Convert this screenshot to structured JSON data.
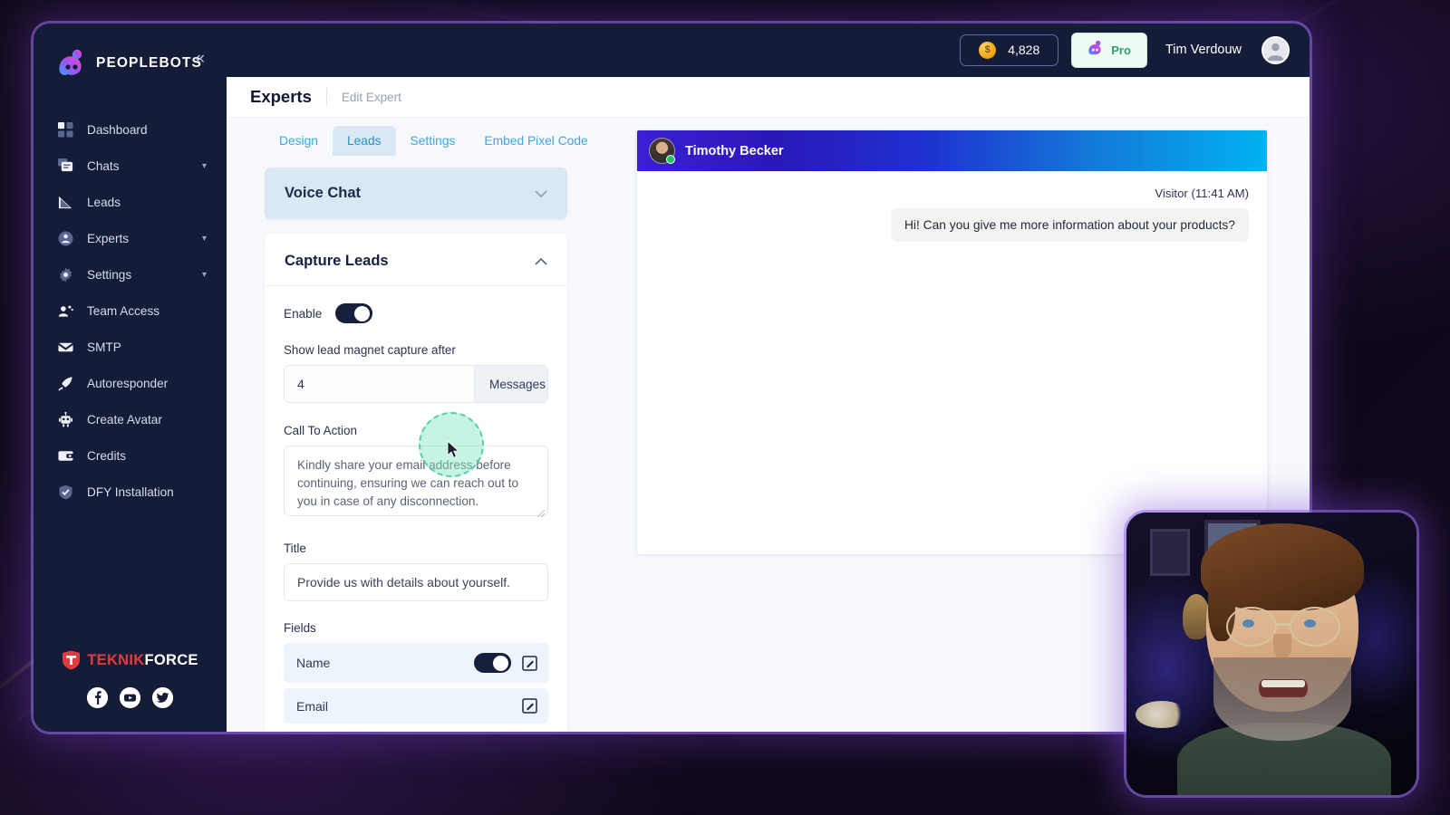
{
  "brand": {
    "name": "PEOPLEBOTS",
    "logo_icon": "peoplebots-logo-icon",
    "collapse_icon": "chevron-double-left-icon"
  },
  "sidebar": {
    "items": [
      {
        "label": "Dashboard",
        "icon": "grid-icon",
        "caret": false
      },
      {
        "label": "Chats",
        "icon": "chat-icon",
        "caret": true
      },
      {
        "label": "Leads",
        "icon": "funnel-icon",
        "caret": false
      },
      {
        "label": "Experts",
        "icon": "user-badge-icon",
        "caret": true
      },
      {
        "label": "Settings",
        "icon": "gear-icon",
        "caret": true
      },
      {
        "label": "Team Access",
        "icon": "team-icon",
        "caret": false
      },
      {
        "label": "SMTP",
        "icon": "envelope-icon",
        "caret": false
      },
      {
        "label": "Autoresponder",
        "icon": "rocket-icon",
        "caret": false
      },
      {
        "label": "Create Avatar",
        "icon": "robot-icon",
        "caret": false
      },
      {
        "label": "Credits",
        "icon": "wallet-icon",
        "caret": false
      },
      {
        "label": "DFY Installation",
        "icon": "shield-check-icon",
        "caret": false
      }
    ],
    "footer": {
      "logo_red": "TEKNIK",
      "logo_white": "FORCE",
      "socials": [
        "facebook-icon",
        "youtube-icon",
        "twitter-icon"
      ]
    }
  },
  "topbar": {
    "credits_value": "4,828",
    "coin_icon": "coin-icon",
    "plan_badge": "Pro",
    "plan_icon": "peoplebots-mini-icon",
    "user_name": "Tim Verdouw",
    "avatar_icon": "user-avatar-icon"
  },
  "page": {
    "title": "Experts",
    "breadcrumb": "Edit Expert"
  },
  "tabs": [
    {
      "label": "Design",
      "active": false
    },
    {
      "label": "Leads",
      "active": true
    },
    {
      "label": "Settings",
      "active": false
    },
    {
      "label": "Embed Pixel Code",
      "active": false
    }
  ],
  "voice_panel": {
    "title": "Voice Chat",
    "chevron": "chevron-down-icon"
  },
  "capture_panel": {
    "title": "Capture Leads",
    "chevron": "chevron-up-icon",
    "enable_label": "Enable",
    "enable_on": true,
    "messages_label": "Show lead magnet capture after",
    "messages_value": "4",
    "messages_suffix": "Messages",
    "cta_label": "Call To Action",
    "cta_value": "Kindly share your email address before continuing, ensuring we can reach out to you in case of any disconnection.",
    "title_label": "Title",
    "title_value": "Provide us with details about yourself.",
    "fields_label": "Fields",
    "fields": [
      {
        "name": "Name",
        "toggle": true,
        "edit_icon": "edit-square-icon"
      },
      {
        "name": "Email",
        "toggle": false,
        "edit_icon": "edit-square-icon"
      }
    ]
  },
  "chat_preview": {
    "agent_name": "Timothy Becker",
    "status": "online",
    "message_meta": "Visitor (11:41 AM)",
    "message_text": "Hi! Can you give me more information about your products?"
  },
  "colors": {
    "sidebar_bg": "#141c38",
    "tab_active_bg": "#d9e8f2",
    "tab_text": "#3ba9e0",
    "toggle_on": "#16203c",
    "chat_gradient_start": "#3b1fd4",
    "chat_gradient_end": "#00b2f0",
    "pro_green": "#2f9e6e",
    "accent_purple": "#966ee6",
    "click_ping": "#7ee6be"
  }
}
